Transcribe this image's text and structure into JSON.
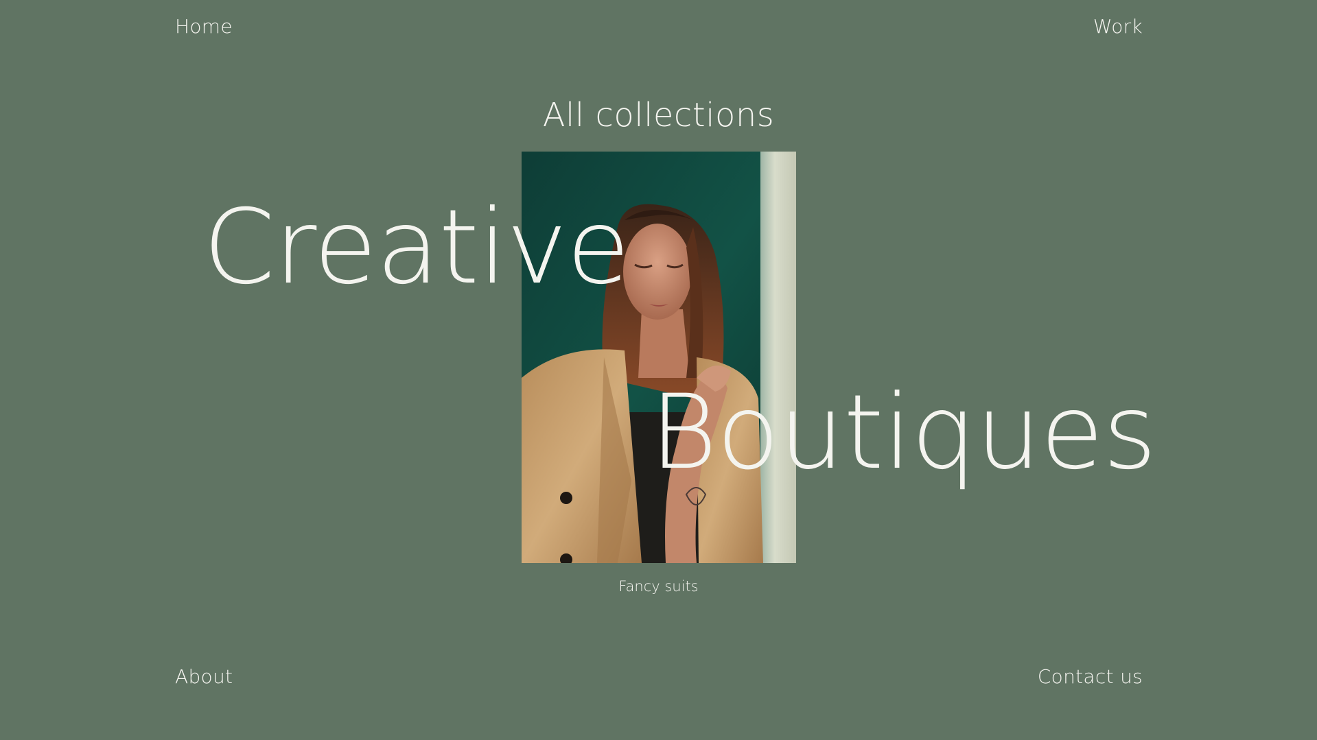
{
  "nav": {
    "home": "Home",
    "work": "Work",
    "about": "About",
    "contact": "Contact us"
  },
  "collections": {
    "title": "All collections"
  },
  "hero": {
    "word_1": "Creative",
    "word_2": "Boutiques"
  },
  "feature": {
    "caption": "Fancy suits"
  },
  "colors": {
    "background": "#607463",
    "text": "#f4f4ef",
    "photo_wall": "#0f4a41",
    "jacket": "#c9a272"
  }
}
